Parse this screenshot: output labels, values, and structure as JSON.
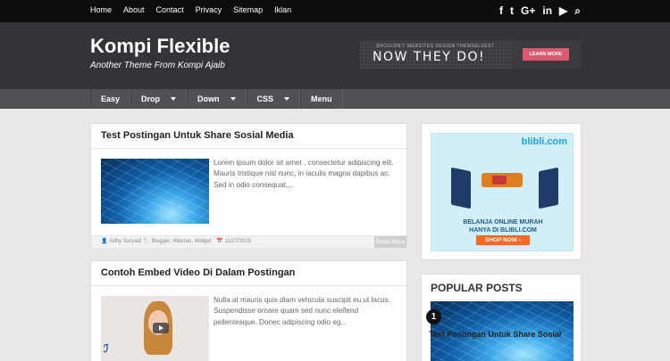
{
  "topnav": {
    "items": [
      "Home",
      "About",
      "Contact",
      "Privacy",
      "Sitemap",
      "Iklan"
    ],
    "social_icons": [
      "facebook-icon",
      "twitter-icon",
      "google-plus-icon",
      "linkedin-icon",
      "youtube-icon",
      "search-icon"
    ],
    "social_glyphs": [
      "f",
      "t",
      "G+",
      "in",
      "▶",
      "⌕"
    ]
  },
  "header": {
    "title": "Kompi Flexible",
    "description": "Another Theme From Kompi Ajaib",
    "banner": {
      "small": "SHOULDN'T WEBSITES DESIGN THEMSELVES?",
      "big": "NOW THEY DO!",
      "button": "LEARN MORE"
    }
  },
  "menu": {
    "items": [
      "Easy",
      "Drop",
      "Down",
      "CSS",
      "Menu"
    ]
  },
  "posts": [
    {
      "title": "Test Postingan Untuk Share Sosial Media",
      "excerpt": "Lorem ipsum dolor sit amet , consectetur adipiscing elit. Mauris tristique nisl nunc, in iaculis magna dapibus ac. Sed in odio consequat,...",
      "author": "Adhy Suryadi",
      "labels": "Blogger, Hiburan, Widget",
      "date": "11/27/2015",
      "read_more": "Read More"
    },
    {
      "title": "Contoh Embed Video Di Dalam Postingan",
      "excerpt": "Nulla at mauris quis diam vehicula suscipit eu ut lacus. Suspendisse ornare quam sed nunc eleifend pellentesque. Donec adipiscing odio eg..."
    }
  ],
  "sidebar": {
    "ad": {
      "brand": "blibli.com",
      "text_line1": "BELANJA ONLINE MURAH",
      "text_line2": "HANYA DI BLIBLI.COM",
      "button": "SHOP NOW ›"
    },
    "popular": {
      "title": "POPULAR POSTS",
      "number": "1",
      "first_title": "Test Postingan Untuk Share Sosial"
    }
  }
}
